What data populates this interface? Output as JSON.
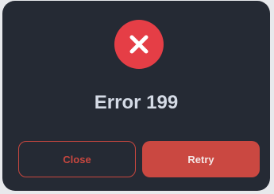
{
  "dialog": {
    "icon": "close-x-icon",
    "title": "Error 199",
    "buttons": {
      "close_label": "Close",
      "retry_label": "Retry"
    }
  },
  "colors": {
    "background": "#252a34",
    "accent_red": "#e53e46",
    "button_red": "#ca4841",
    "title_text": "#d5dbe6"
  }
}
